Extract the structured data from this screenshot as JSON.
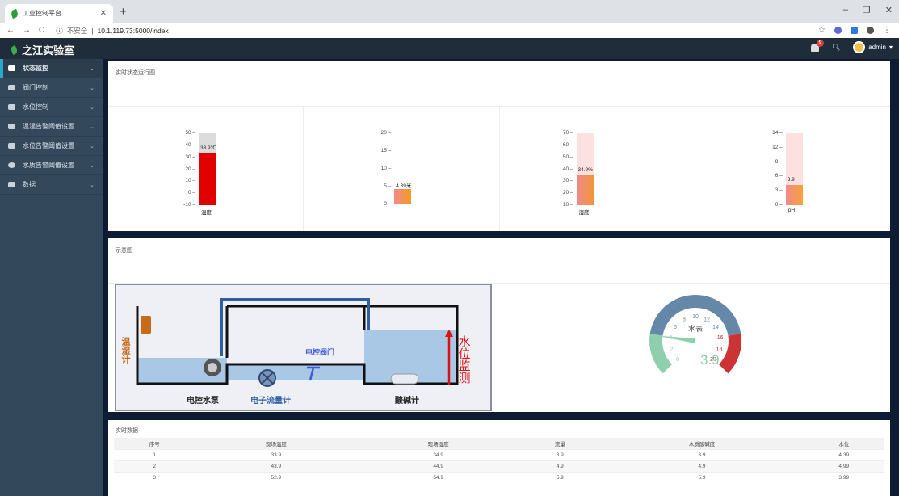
{
  "browser": {
    "tab_title": "工业控制平台",
    "insecure_label": "不安全",
    "url": "10.1.119.73:5000/index"
  },
  "app": {
    "brand": "之江实验室",
    "bell_count": "9",
    "user": "admin"
  },
  "sidebar": {
    "items": [
      {
        "label": "状态监控",
        "icon": "monitor-icon",
        "active": true
      },
      {
        "label": "阀门控制",
        "icon": "cloud-icon"
      },
      {
        "label": "水位控制",
        "icon": "water-icon"
      },
      {
        "label": "温湿告警阈值设置",
        "icon": "image-icon"
      },
      {
        "label": "水位告警阈值设置",
        "icon": "film-icon"
      },
      {
        "label": "水质告警阈值设置",
        "icon": "gear-icon"
      },
      {
        "label": "数据",
        "icon": "user-group-icon"
      }
    ]
  },
  "panel1": {
    "title": "实时状态运行图"
  },
  "panel2": {
    "title": "示意图"
  },
  "panel3": {
    "title": "实时数据"
  },
  "thermometers": [
    {
      "name": "温度",
      "value_label": "33.9℃",
      "value": 33.9,
      "min": -10,
      "max": 50,
      "ticks": [
        "50",
        "40",
        "30",
        "20",
        "10",
        "0",
        "-10"
      ],
      "color": "#e00000"
    },
    {
      "name": "",
      "value_label": "4.39米",
      "value": 4.39,
      "min": 0,
      "max": 20,
      "ticks": [
        "20",
        "15",
        "10",
        "5",
        "0"
      ],
      "color": "#f59a23"
    },
    {
      "name": "湿度",
      "value_label": "34.9%",
      "value": 34.9,
      "min": 10,
      "max": 70,
      "ticks": [
        "70",
        "60",
        "50",
        "40",
        "30",
        "20",
        "10"
      ],
      "color": "#f0953a"
    },
    {
      "name": "pH",
      "value_label": "3.9",
      "value": 3.9,
      "min": 0,
      "max": 14,
      "ticks": [
        "14",
        "12",
        "9",
        "6",
        "3",
        "0"
      ],
      "color": "#f7a23a"
    }
  ],
  "diagram": {
    "thermo_label": "温湿计",
    "pump_label": "电控水泵",
    "flowmeter_label": "电子流量计",
    "valve_label": "电控阀门",
    "ph_label": "酸碱计",
    "level_label": "水位监测"
  },
  "gauge": {
    "title": "水表",
    "value": "3.9",
    "ticks": [
      "0",
      "2",
      "4",
      "6",
      "8",
      "10",
      "12",
      "14",
      "16",
      "18",
      "20"
    ]
  },
  "table": {
    "headers": [
      "序号",
      "现场温度",
      "现场湿度",
      "流量",
      "水质酸碱度",
      "水位"
    ],
    "rows": [
      [
        "1",
        "33.9",
        "34.9",
        "3.9",
        "3.9",
        "4.39"
      ],
      [
        "2",
        "43.9",
        "44.9",
        "4.9",
        "4.9",
        "4.99"
      ],
      [
        "3",
        "52.9",
        "54.9",
        "5.9",
        "5.9",
        "3.99"
      ]
    ]
  }
}
